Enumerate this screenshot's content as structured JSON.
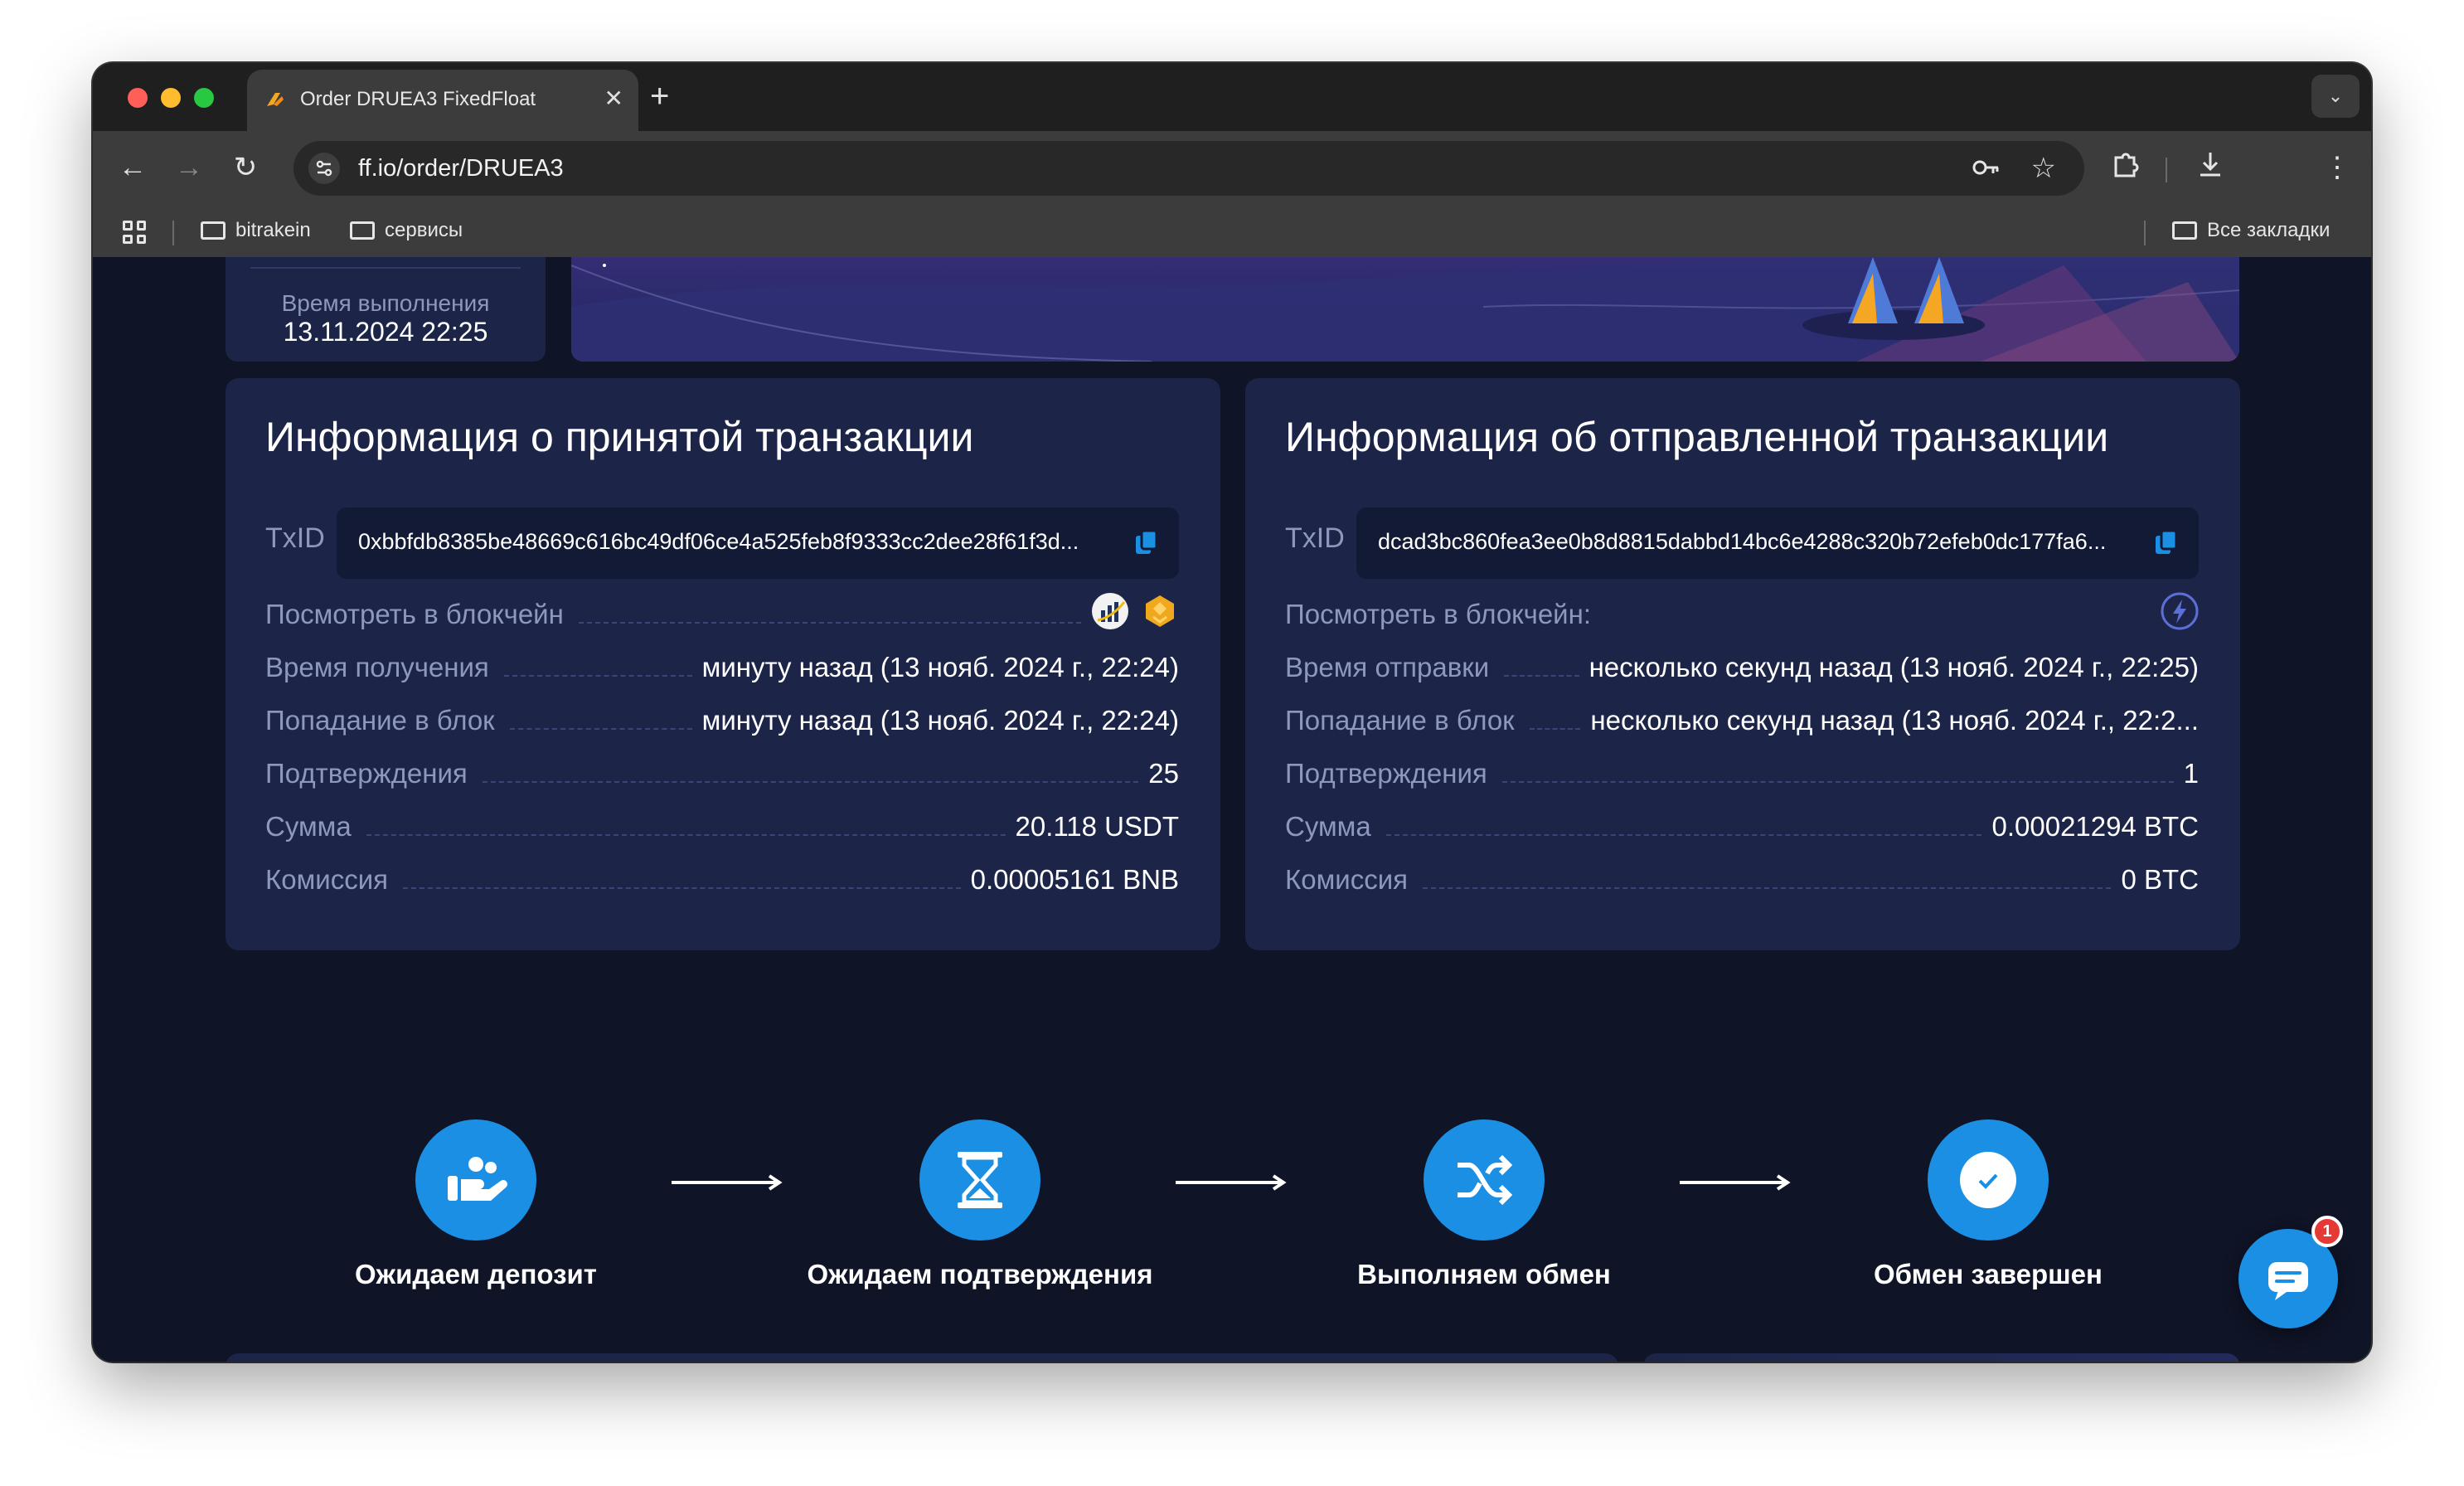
{
  "browser": {
    "tab_title": "Order DRUEA3 FixedFloat",
    "url": "ff.io/order/DRUEA3",
    "bookmarks": [
      "bitrakein",
      "сервисы"
    ],
    "all_bookmarks": "Все закладки"
  },
  "order": {
    "time_label": "Время выполнения",
    "time_value": "13.11.2024 22:25"
  },
  "received": {
    "title": "Информация о принятой транзакции",
    "txid_label": "TxID",
    "txid": "0xbbfdb8385be48669c616bc49df06ce4a525feb8f9333cc2dee28f61f3d...",
    "explorer_label": "Посмотреть в блокчейн",
    "time_label": "Время получения",
    "time_value": "минуту назад (13 нояб. 2024 г., 22:24)",
    "block_label": "Попадание в блок",
    "block_value": "минуту назад (13 нояб. 2024 г., 22:24)",
    "conf_label": "Подтверждения",
    "conf_value": "25",
    "amount_label": "Сумма",
    "amount_value": "20.118 USDT",
    "fee_label": "Комиссия",
    "fee_value": "0.00005161 BNB"
  },
  "sent": {
    "title": "Информация об отправленной транзакции",
    "txid_label": "TxID",
    "txid": "dcad3bc860fea3ee0b8d8815dabbd14bc6e4288c320b72efeb0dc177fa6...",
    "explorer_label": "Посмотреть в блокчейн:",
    "time_label": "Время отправки",
    "time_value": "несколько секунд назад (13 нояб. 2024 г., 22:25)",
    "block_label": "Попадание в блок",
    "block_value": "несколько секунд назад (13 нояб. 2024 г., 22:2...",
    "conf_label": "Подтверждения",
    "conf_value": "1",
    "amount_label": "Сумма",
    "amount_value": "0.00021294 BTC",
    "fee_label": "Комиссия",
    "fee_value": "0 BTC"
  },
  "steps": [
    "Ожидаем депозит",
    "Ожидаем подтверждения",
    "Выполняем обмен",
    "Обмен завершен"
  ],
  "chat_badge": "1",
  "colors": {
    "accent": "#1a8fe3",
    "card": "#1c2548",
    "page": "#0f1426"
  }
}
